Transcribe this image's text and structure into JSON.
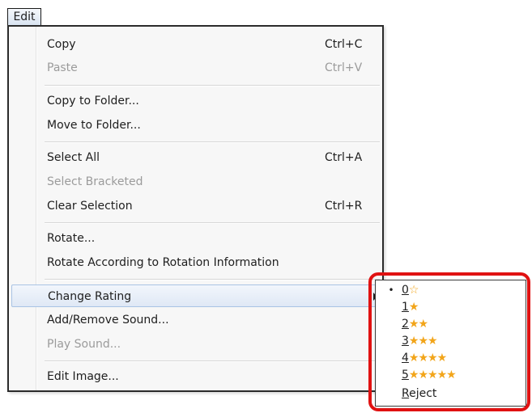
{
  "menubar": {
    "edit_label": "Edit"
  },
  "menu": {
    "items": [
      {
        "label": "Copy",
        "shortcut": "Ctrl+C"
      },
      {
        "label": "Paste",
        "shortcut": "Ctrl+V"
      },
      {
        "label": "Copy to Folder..."
      },
      {
        "label": "Move to Folder..."
      },
      {
        "label": "Select All",
        "shortcut": "Ctrl+A"
      },
      {
        "label": "Select Bracketed"
      },
      {
        "label": "Clear Selection",
        "shortcut": "Ctrl+R"
      },
      {
        "label": "Rotate..."
      },
      {
        "label": "Rotate According to Rotation Information"
      },
      {
        "label": "Change Rating"
      },
      {
        "label": "Add/Remove Sound..."
      },
      {
        "label": "Play Sound..."
      },
      {
        "label": "Edit Image..."
      }
    ]
  },
  "submenu": {
    "items": [
      {
        "num": "0",
        "stars": "☆",
        "selected": true
      },
      {
        "num": "1",
        "stars": "★"
      },
      {
        "num": "2",
        "stars": "★★"
      },
      {
        "num": "3",
        "stars": "★★★"
      },
      {
        "num": "4",
        "stars": "★★★★"
      },
      {
        "num": "5",
        "stars": "★★★★★"
      }
    ],
    "reject": {
      "first": "R",
      "rest": "eject"
    },
    "bullet": "•"
  },
  "colors": {
    "star": "#f2a51a",
    "callout": "#e01212",
    "highlight": "#dfe8f5"
  }
}
